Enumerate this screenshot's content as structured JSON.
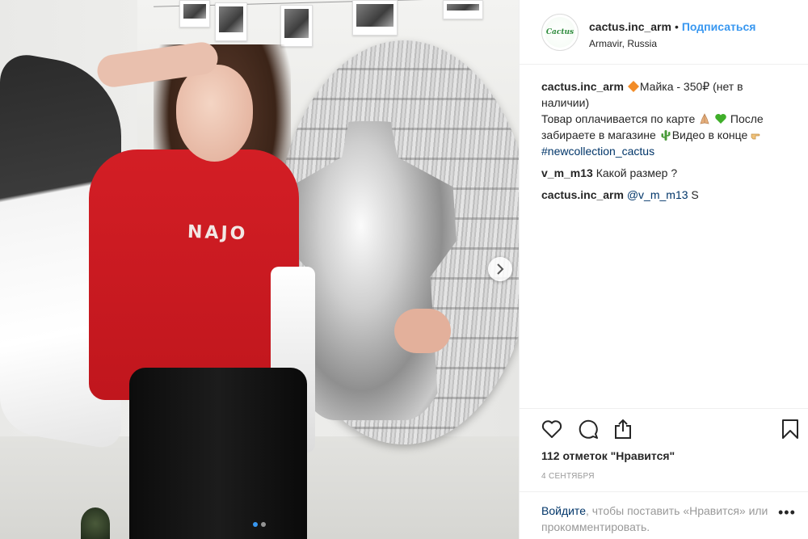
{
  "post": {
    "username": "cactus.inc_arm",
    "follow_label": "Подписаться",
    "separator": "•",
    "location": "Armavir, Russia",
    "avatar_text": "Cactus"
  },
  "photo": {
    "shirt_print": "NAJO",
    "carousel_dots": 2,
    "active_dot": 1
  },
  "caption": {
    "username": "cactus.inc_arm",
    "line1": "Майка - 350₽ (нет в наличии)",
    "line2": "Товар оплачивается по карте",
    "line3": "После забираете в магазине",
    "line4": "Видео в конце",
    "hashtag": "#newcollection_cactus"
  },
  "comments": [
    {
      "user": "v_m_m13",
      "text": "Какой размер ?"
    },
    {
      "user": "cactus.inc_arm",
      "mention": "@v_m_m13",
      "text": "S"
    }
  ],
  "likes_text": "112 отметок \"Нравится\"",
  "date": "4 сентября",
  "footer": {
    "login_link": "Войдите",
    "login_rest": ", чтобы поставить «Нравится» или прокомментировать.",
    "more": "•••"
  },
  "icons": {
    "like": "heart-icon",
    "comment": "comment-icon",
    "share": "share-icon",
    "save": "bookmark-icon",
    "next": "chevron-right-icon",
    "emoji_diamond": "orange-diamond-icon",
    "emoji_hands": "folded-hands-icon",
    "emoji_heart": "green-heart-icon",
    "emoji_cactus": "cactus-icon",
    "emoji_point": "pointing-hand-icon"
  },
  "colors": {
    "link": "#3897f0",
    "hashtag": "#003569",
    "muted": "#999999",
    "shirt": "#d31e25"
  }
}
